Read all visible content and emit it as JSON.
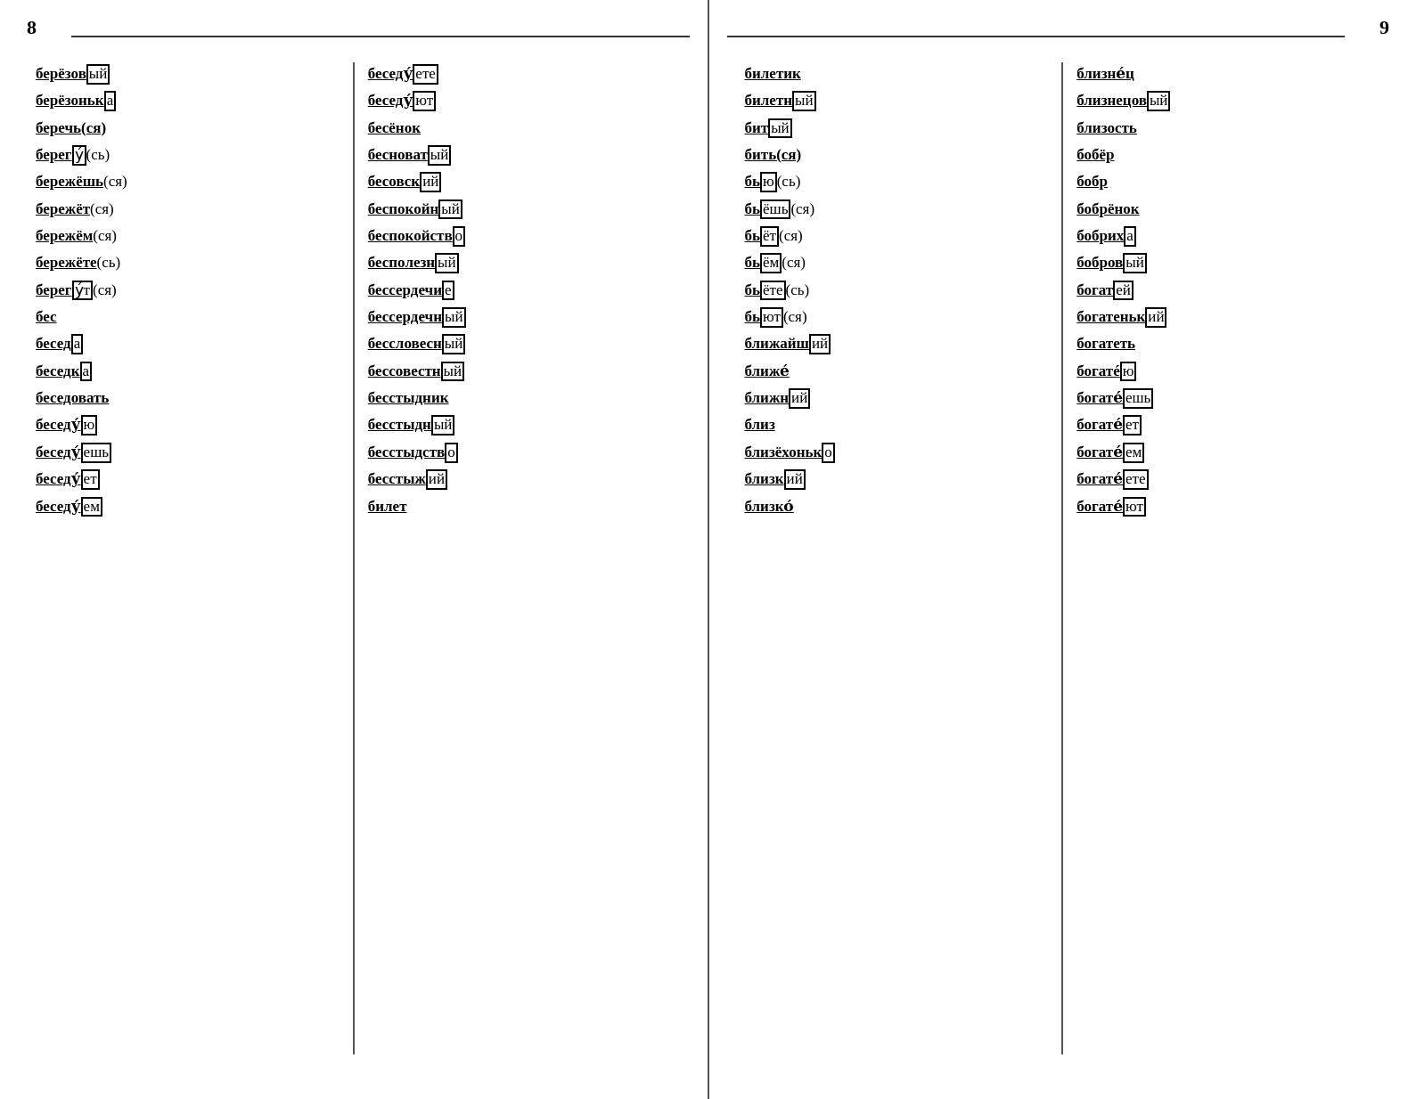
{
  "leftPage": {
    "number": "8",
    "col1": [
      "берёзов ый",
      "берёзоньк а",
      "беречь(ся)",
      "берег у (сь)",
      "бережёшь (ся)",
      "бережёт (ся)",
      "бережём (ся)",
      "бережёте (сь)",
      "берег ут (ся)",
      "бес",
      "бесед а",
      "беседк а",
      "беседовать",
      "беседу ю",
      "беседу ешь",
      "беседу ет",
      "беседу ем"
    ],
    "col2": [
      "беседу ете",
      "беседу ют",
      "бесёнок",
      "бесноват ый",
      "бесовск ий",
      "беспокойн ый",
      "беспокойств о",
      "бесполезн ый",
      "бессердечи е",
      "бессердечн ый",
      "бессловесн ый",
      "бессовестн ый",
      "бесстыдник",
      "бесстыдн ый",
      "бесстыдств о",
      "бесстыж ий",
      "билет"
    ]
  },
  "rightPage": {
    "number": "9",
    "col1": [
      "билетик",
      "билетн ый",
      "бит ый",
      "бить(ся)",
      "бь ю (сь)",
      "бь ёшь (ся)",
      "бь ёт (ся)",
      "бь ём (ся)",
      "бь ёте (сь)",
      "бь ют (ся)",
      "ближайш ий",
      "ближе",
      "ближн ий",
      "близ",
      "близёхоньк о",
      "близк ий",
      "близко"
    ],
    "col2": [
      "близнец",
      "близнецов ый",
      "близость",
      "бобёр",
      "бобр",
      "бобрёнок",
      "бобрих а",
      "бобров ый",
      "богат ей",
      "богатеньк ий",
      "богатеть",
      "богате ю",
      "богате ешь",
      "богате ет",
      "богате ем",
      "богате ете",
      "богате ют"
    ]
  }
}
